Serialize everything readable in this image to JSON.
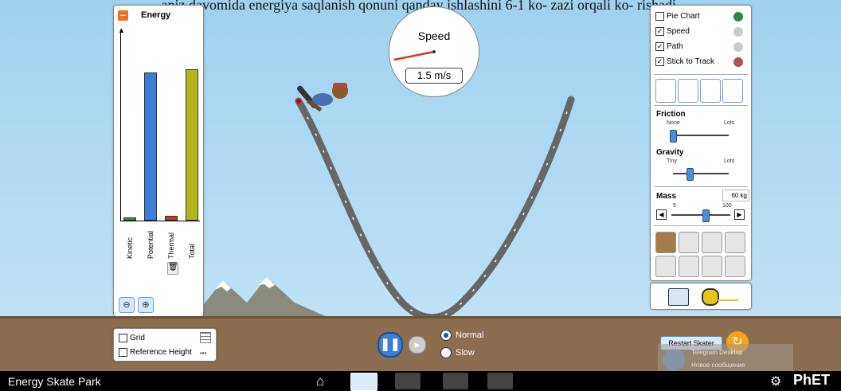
{
  "caption": "aniz davomida energiya saqlanish qonuni qanday ishlashini 6-1 ko- zazi orqali ko- rishadi.",
  "energy_panel": {
    "title": "Energy",
    "bars": [
      {
        "label": "Kinetic",
        "value": 0.02,
        "color": "#2f9c3e"
      },
      {
        "label": "Potential",
        "value": 0.98,
        "color": "#3b7dd8"
      },
      {
        "label": "Thermal",
        "value": 0.03,
        "color": "#c1382d"
      },
      {
        "label": "Total",
        "value": 1.0,
        "color": "#b4b41c"
      }
    ],
    "zoom_out_icon": "zoom-out-icon",
    "zoom_in_icon": "zoom-in-icon",
    "trash_icon": "trash-icon"
  },
  "speedometer": {
    "title": "Speed",
    "readout": "1.5 m/s"
  },
  "right_panel": {
    "checkboxes": [
      {
        "label": "Pie Chart",
        "checked": false,
        "icon": "pie-chart-icon"
      },
      {
        "label": "Speed",
        "checked": true,
        "icon": "speedometer-icon"
      },
      {
        "label": "Path",
        "checked": true,
        "icon": "path-icon"
      },
      {
        "label": "Stick to Track",
        "checked": true,
        "icon": "track-icon"
      }
    ],
    "friction": {
      "title": "Friction",
      "min_label": "None",
      "max_label": "Lots",
      "level": 0.0
    },
    "gravity": {
      "title": "Gravity",
      "min_label": "Tiny",
      "max_label": "Lots",
      "level": 0.3
    },
    "mass": {
      "title": "Mass",
      "value": "60 kg",
      "min_label": "5",
      "max_label": "100",
      "level": 0.58
    }
  },
  "bottom_controls": {
    "grid_label": "Grid",
    "reference_height_label": "Reference Height",
    "normal_label": "Normal",
    "slow_label": "Slow",
    "selected_speed": "Normal",
    "restart_label": "Restart Skater"
  },
  "notification": {
    "line1": "Telegram Desktop",
    "line2": "Новое сообщение"
  },
  "footer": {
    "app_title": "Energy Skate Park",
    "brand": "PhET"
  }
}
